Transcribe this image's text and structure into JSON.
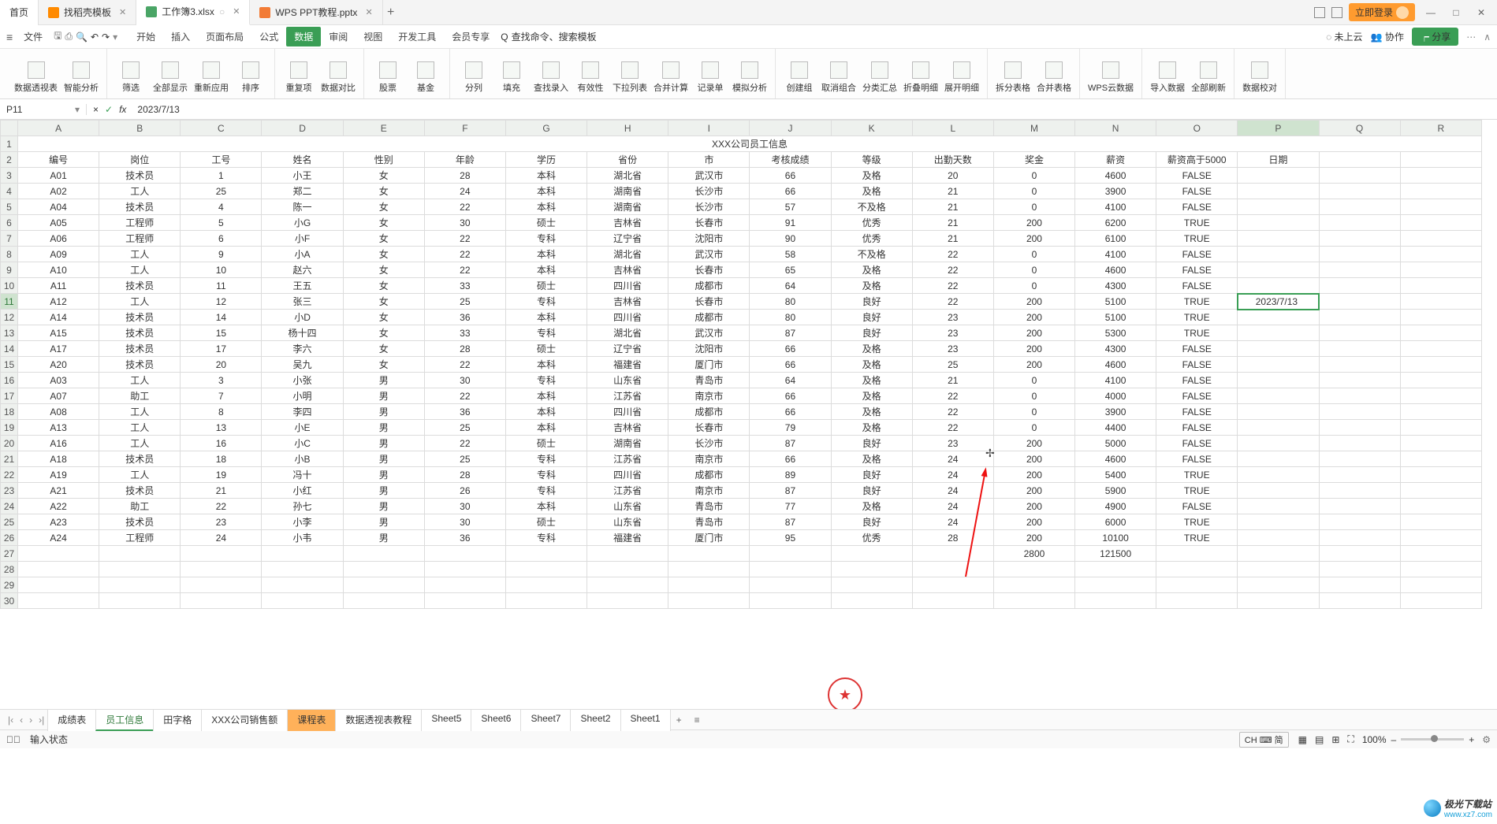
{
  "window": {
    "home": "首页",
    "tabs": [
      {
        "icon": "star",
        "label": "找稻壳模板"
      },
      {
        "icon": "sheet",
        "label": "工作簿3.xlsx",
        "active": true,
        "dirty": true
      },
      {
        "icon": "ppt",
        "label": "WPS PPT教程.pptx"
      }
    ],
    "login": "立即登录"
  },
  "quick": {
    "file": "文件",
    "undo": "↶",
    "redo": "↷"
  },
  "menu": {
    "items": [
      "开始",
      "插入",
      "页面布局",
      "公式",
      "数据",
      "审阅",
      "视图",
      "开发工具",
      "会员专享"
    ],
    "active": 4,
    "search_placeholder": "查找命令、搜索模板",
    "search_icon_label": "Q",
    "cloud": "未上云",
    "coop": "协作",
    "share": "分享"
  },
  "ribbon": {
    "groups": [
      [
        "数据透视表",
        "智能分析"
      ],
      [
        "筛选",
        "全部显示",
        "重新应用",
        "排序"
      ],
      [
        "重复项",
        "数据对比"
      ],
      [
        "股票",
        "基金"
      ],
      [
        "分列",
        "填充",
        "查找录入",
        "有效性",
        "下拉列表",
        "合并计算",
        "记录单",
        "模拟分析"
      ],
      [
        "创建组",
        "取消组合",
        "分类汇总",
        "折叠明细",
        "展开明细"
      ],
      [
        "拆分表格",
        "合并表格"
      ],
      [
        "WPS云数据"
      ],
      [
        "导入数据",
        "全部刷新"
      ],
      [
        "数据校对"
      ]
    ]
  },
  "fx": {
    "cell": "P11",
    "cancel": "×",
    "ok": "✓",
    "fx": "fx",
    "formula": "2023/7/13"
  },
  "columns": [
    "A",
    "B",
    "C",
    "D",
    "E",
    "F",
    "G",
    "H",
    "I",
    "J",
    "K",
    "L",
    "M",
    "N",
    "O",
    "P",
    "Q",
    "R"
  ],
  "title_row": "XXX公司员工信息",
  "headers": [
    "编号",
    "岗位",
    "工号",
    "姓名",
    "性别",
    "年龄",
    "学历",
    "省份",
    "市",
    "考核成绩",
    "等级",
    "出勤天数",
    "奖金",
    "薪资",
    "薪资高于5000",
    "日期"
  ],
  "editing_value": "2023/7/13",
  "rows": [
    [
      "A01",
      "技术员",
      "1",
      "小王",
      "女",
      "28",
      "本科",
      "湖北省",
      "武汉市",
      "66",
      "及格",
      "20",
      "0",
      "4600",
      "FALSE",
      ""
    ],
    [
      "A02",
      "工人",
      "25",
      "郑二",
      "女",
      "24",
      "本科",
      "湖南省",
      "长沙市",
      "66",
      "及格",
      "21",
      "0",
      "3900",
      "FALSE",
      ""
    ],
    [
      "A04",
      "技术员",
      "4",
      "陈一",
      "女",
      "22",
      "本科",
      "湖南省",
      "长沙市",
      "57",
      "不及格",
      "21",
      "0",
      "4100",
      "FALSE",
      ""
    ],
    [
      "A05",
      "工程师",
      "5",
      "小G",
      "女",
      "30",
      "硕士",
      "吉林省",
      "长春市",
      "91",
      "优秀",
      "21",
      "200",
      "6200",
      "TRUE",
      ""
    ],
    [
      "A06",
      "工程师",
      "6",
      "小F",
      "女",
      "22",
      "专科",
      "辽宁省",
      "沈阳市",
      "90",
      "优秀",
      "21",
      "200",
      "6100",
      "TRUE",
      ""
    ],
    [
      "A09",
      "工人",
      "9",
      "小A",
      "女",
      "22",
      "本科",
      "湖北省",
      "武汉市",
      "58",
      "不及格",
      "22",
      "0",
      "4100",
      "FALSE",
      ""
    ],
    [
      "A10",
      "工人",
      "10",
      "赵六",
      "女",
      "22",
      "本科",
      "吉林省",
      "长春市",
      "65",
      "及格",
      "22",
      "0",
      "4600",
      "FALSE",
      ""
    ],
    [
      "A11",
      "技术员",
      "11",
      "王五",
      "女",
      "33",
      "硕士",
      "四川省",
      "成都市",
      "64",
      "及格",
      "22",
      "0",
      "4300",
      "FALSE",
      ""
    ],
    [
      "A12",
      "工人",
      "12",
      "张三",
      "女",
      "25",
      "专科",
      "吉林省",
      "长春市",
      "80",
      "良好",
      "22",
      "200",
      "5100",
      "TRUE",
      "2023/7/13"
    ],
    [
      "A14",
      "技术员",
      "14",
      "小D",
      "女",
      "36",
      "本科",
      "四川省",
      "成都市",
      "80",
      "良好",
      "23",
      "200",
      "5100",
      "TRUE",
      ""
    ],
    [
      "A15",
      "技术员",
      "15",
      "杨十四",
      "女",
      "33",
      "专科",
      "湖北省",
      "武汉市",
      "87",
      "良好",
      "23",
      "200",
      "5300",
      "TRUE",
      ""
    ],
    [
      "A17",
      "技术员",
      "17",
      "李六",
      "女",
      "28",
      "硕士",
      "辽宁省",
      "沈阳市",
      "66",
      "及格",
      "23",
      "200",
      "4300",
      "FALSE",
      ""
    ],
    [
      "A20",
      "技术员",
      "20",
      "吴九",
      "女",
      "22",
      "本科",
      "福建省",
      "厦门市",
      "66",
      "及格",
      "25",
      "200",
      "4600",
      "FALSE",
      ""
    ],
    [
      "A03",
      "工人",
      "3",
      "小张",
      "男",
      "30",
      "专科",
      "山东省",
      "青岛市",
      "64",
      "及格",
      "21",
      "0",
      "4100",
      "FALSE",
      ""
    ],
    [
      "A07",
      "助工",
      "7",
      "小明",
      "男",
      "22",
      "本科",
      "江苏省",
      "南京市",
      "66",
      "及格",
      "22",
      "0",
      "4000",
      "FALSE",
      ""
    ],
    [
      "A08",
      "工人",
      "8",
      "李四",
      "男",
      "36",
      "本科",
      "四川省",
      "成都市",
      "66",
      "及格",
      "22",
      "0",
      "3900",
      "FALSE",
      ""
    ],
    [
      "A13",
      "工人",
      "13",
      "小E",
      "男",
      "25",
      "本科",
      "吉林省",
      "长春市",
      "79",
      "及格",
      "22",
      "0",
      "4400",
      "FALSE",
      ""
    ],
    [
      "A16",
      "工人",
      "16",
      "小C",
      "男",
      "22",
      "硕士",
      "湖南省",
      "长沙市",
      "87",
      "良好",
      "23",
      "200",
      "5000",
      "FALSE",
      ""
    ],
    [
      "A18",
      "技术员",
      "18",
      "小B",
      "男",
      "25",
      "专科",
      "江苏省",
      "南京市",
      "66",
      "及格",
      "24",
      "200",
      "4600",
      "FALSE",
      ""
    ],
    [
      "A19",
      "工人",
      "19",
      "冯十",
      "男",
      "28",
      "专科",
      "四川省",
      "成都市",
      "89",
      "良好",
      "24",
      "200",
      "5400",
      "TRUE",
      ""
    ],
    [
      "A21",
      "技术员",
      "21",
      "小红",
      "男",
      "26",
      "专科",
      "江苏省",
      "南京市",
      "87",
      "良好",
      "24",
      "200",
      "5900",
      "TRUE",
      ""
    ],
    [
      "A22",
      "助工",
      "22",
      "孙七",
      "男",
      "30",
      "本科",
      "山东省",
      "青岛市",
      "77",
      "及格",
      "24",
      "200",
      "4900",
      "FALSE",
      ""
    ],
    [
      "A23",
      "技术员",
      "23",
      "小李",
      "男",
      "30",
      "硕士",
      "山东省",
      "青岛市",
      "87",
      "良好",
      "24",
      "200",
      "6000",
      "TRUE",
      ""
    ],
    [
      "A24",
      "工程师",
      "24",
      "小韦",
      "男",
      "36",
      "专科",
      "福建省",
      "厦门市",
      "95",
      "优秀",
      "28",
      "200",
      "10100",
      "TRUE",
      ""
    ]
  ],
  "totals": {
    "bonus": "2800",
    "salary": "121500"
  },
  "sheets": {
    "list": [
      "成绩表",
      "员工信息",
      "田字格",
      "XXX公司销售额",
      "课程表",
      "数据透视表教程",
      "Sheet5",
      "Sheet6",
      "Sheet7",
      "Sheet2",
      "Sheet1"
    ],
    "active": 1,
    "highlight": 4
  },
  "status": {
    "mode": "输入状态",
    "ime": "CH ⌨ 简",
    "zoom": "100%"
  },
  "watermark": {
    "text": "极光下载站",
    "url": "www.xz7.com"
  }
}
